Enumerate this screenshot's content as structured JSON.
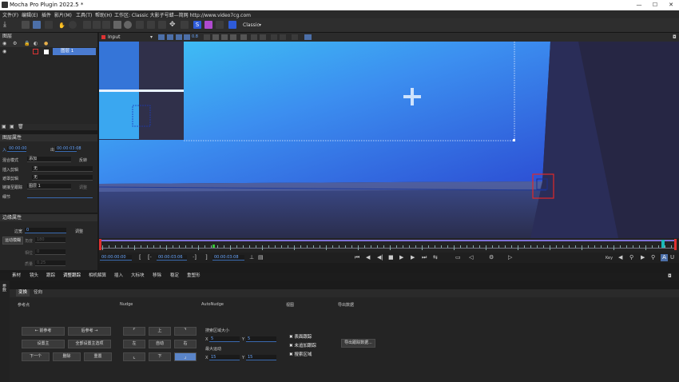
{
  "window": {
    "title": "Mocha Pro Plugin 2022.5 *",
    "min": "—",
    "max": "☐",
    "close": "✕"
  },
  "menu": [
    "文件(F)",
    "编辑(E)",
    "插件",
    "影片(M)",
    "工具(T)",
    "帮助(H)",
    "工作区: Classic 大影子号蜡—简网 http://www.video7cg.com"
  ],
  "toolbar": {
    "workspace": "Classic",
    "opacity_value": "0.8"
  },
  "viewer_header": {
    "clip": "Input"
  },
  "layers_panel": {
    "title": "图层",
    "layer_name": "图层 1"
  },
  "layer_props": {
    "title": "图层属性",
    "in_label": "入",
    "in_value": "00:00:00",
    "out_label": "出",
    "out_value": "00:00:03:08",
    "blend_label": "混合模式",
    "blend_value": "添加",
    "invert_label": "反转",
    "insert_label": "插入剪辑",
    "insert_value": "无",
    "matte_label": "遮罩剪辑",
    "matte_value": "无",
    "link_label": "链接至跟踪",
    "link_value": "图层 1",
    "link_btn": "调整",
    "detail_label": "细节"
  },
  "edge_props": {
    "title": "边缘属性",
    "edge_label": "边宽",
    "edge_value": "0",
    "adjust_btn": "调整",
    "motion_blur_btn": "运动模糊",
    "angle_label": "角度",
    "angle_value": "180",
    "phase_label": "相位",
    "phase_value": "0",
    "quality_label": "质量",
    "quality_value": "0.25"
  },
  "timeline": {
    "current_time": "00:00:00:00",
    "in_time": "00:00:03:06",
    "out_time": "00:00:03:08",
    "key_label": "Key"
  },
  "module_tabs": [
    "素材",
    "镜头",
    "跟踪",
    "调整跟踪",
    "相机解算",
    "插入",
    "大标块",
    "移除",
    "稳定",
    "重塑形"
  ],
  "sub_tabs": [
    "变换",
    "径向"
  ],
  "side_tab": "参数",
  "columns": {
    "ref_point": "参考点",
    "nudge": "Nudge",
    "autonudge": "AutoNudge",
    "view": "视图",
    "export": "导出数据"
  },
  "ref_buttons": {
    "prev_ref": "← 前参考",
    "next_ref": "后参考 →",
    "set_master": "设置主",
    "set_all_master": "全部设置主选项",
    "next": "下一个",
    "delete": "删除",
    "reset": "重置"
  },
  "nudge_buttons": {
    "up": "上",
    "left": "左",
    "auto": "自动",
    "right": "右",
    "down": "下"
  },
  "autonudge": {
    "search_label": "搜索区域大小",
    "search_x": "5",
    "search_y": "5",
    "max_label": "最大运动",
    "max_x": "15",
    "max_y": "15"
  },
  "view_checks": [
    "表面跟踪",
    "未追加跟踪",
    "搜索区域"
  ],
  "export_btn": "导出跟踪数据..."
}
